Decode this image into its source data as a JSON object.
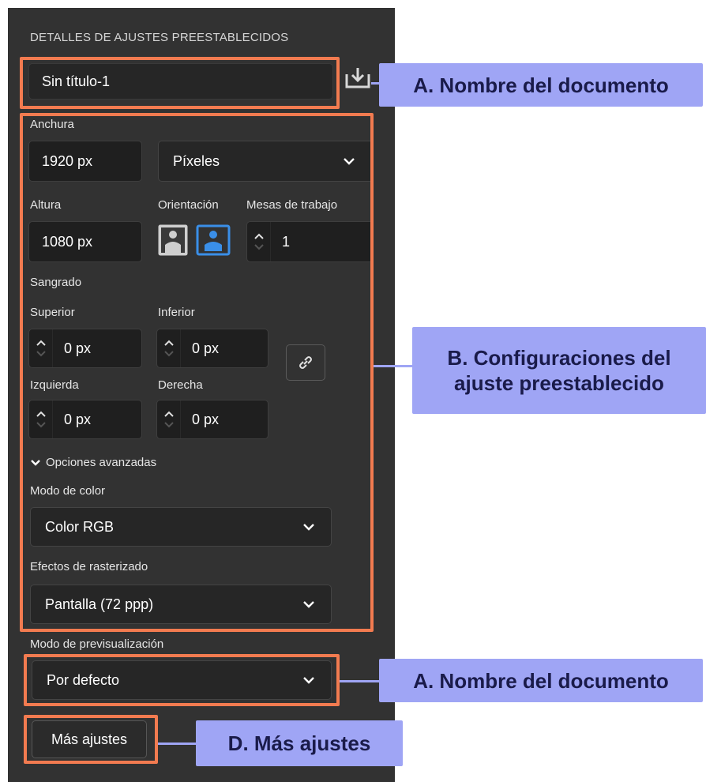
{
  "panel": {
    "heading": "DETALLES DE AJUSTES PREESTABLECIDOS",
    "document_name": "Sin título-1",
    "width": {
      "label": "Anchura",
      "value": "1920 px",
      "unit": "Píxeles"
    },
    "height": {
      "label": "Altura",
      "value": "1080 px"
    },
    "orientation": {
      "label": "Orientación",
      "selected": "landscape"
    },
    "artboards": {
      "label": "Mesas de trabajo",
      "value": "1"
    },
    "bleed": {
      "label": "Sangrado",
      "top": {
        "label": "Superior",
        "value": "0 px"
      },
      "bottom": {
        "label": "Inferior",
        "value": "0 px"
      },
      "left": {
        "label": "Izquierda",
        "value": "0 px"
      },
      "right": {
        "label": "Derecha",
        "value": "0 px"
      }
    },
    "advanced_toggle": "Opciones avanzadas",
    "color_mode": {
      "label": "Modo de color",
      "value": "Color RGB"
    },
    "raster_effects": {
      "label": "Efectos de rasterizado",
      "value": "Pantalla (72 ppp)"
    },
    "preview_mode": {
      "label": "Modo de previsualización",
      "value": "Por defecto"
    },
    "more_settings": "Más ajustes"
  },
  "callouts": {
    "a_top": "A. Nombre del documento",
    "b": "B. Configuraciones del ajuste preestablecido",
    "a_bottom": "A. Nombre del documento",
    "d": "D. Más ajustes"
  },
  "colors": {
    "panel_bg": "#323232",
    "highlight": "#f27b50",
    "callout_bg": "#9fa5f5",
    "callout_text": "#1a1b4a",
    "accent_blue": "#3a8fe8"
  }
}
